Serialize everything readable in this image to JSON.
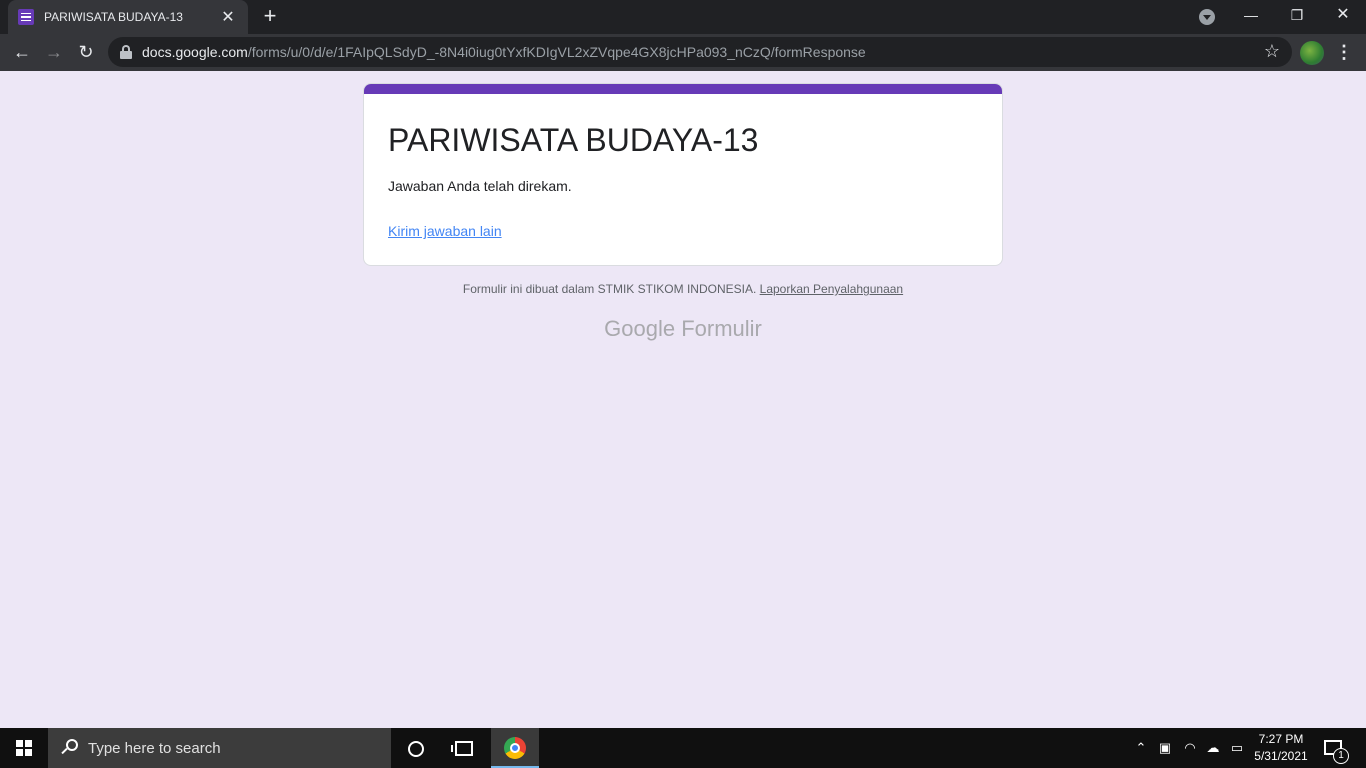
{
  "browser": {
    "tab_title": "PARIWISATA BUDAYA-13",
    "url_host": "docs.google.com",
    "url_path": "/forms/u/0/d/e/1FAIpQLSdyD_-8N4i0iug0tYxfKDIgVL2xZVqpe4GX8jcHPa093_nCzQ/formResponse"
  },
  "form": {
    "title": "PARIWISATA BUDAYA-13",
    "confirmation": "Jawaban Anda telah direkam.",
    "submit_another": "Kirim jawaban lain",
    "accent_color": "#673ab7"
  },
  "footer": {
    "text": "Formulir ini dibuat dalam STMIK STIKOM INDONESIA.",
    "report_link": "Laporkan Penyalahgunaan",
    "brand_google": "Google",
    "brand_product": "Formulir"
  },
  "taskbar": {
    "search_placeholder": "Type here to search",
    "time": "7:27 PM",
    "date": "5/31/2021",
    "notification_count": "1"
  }
}
